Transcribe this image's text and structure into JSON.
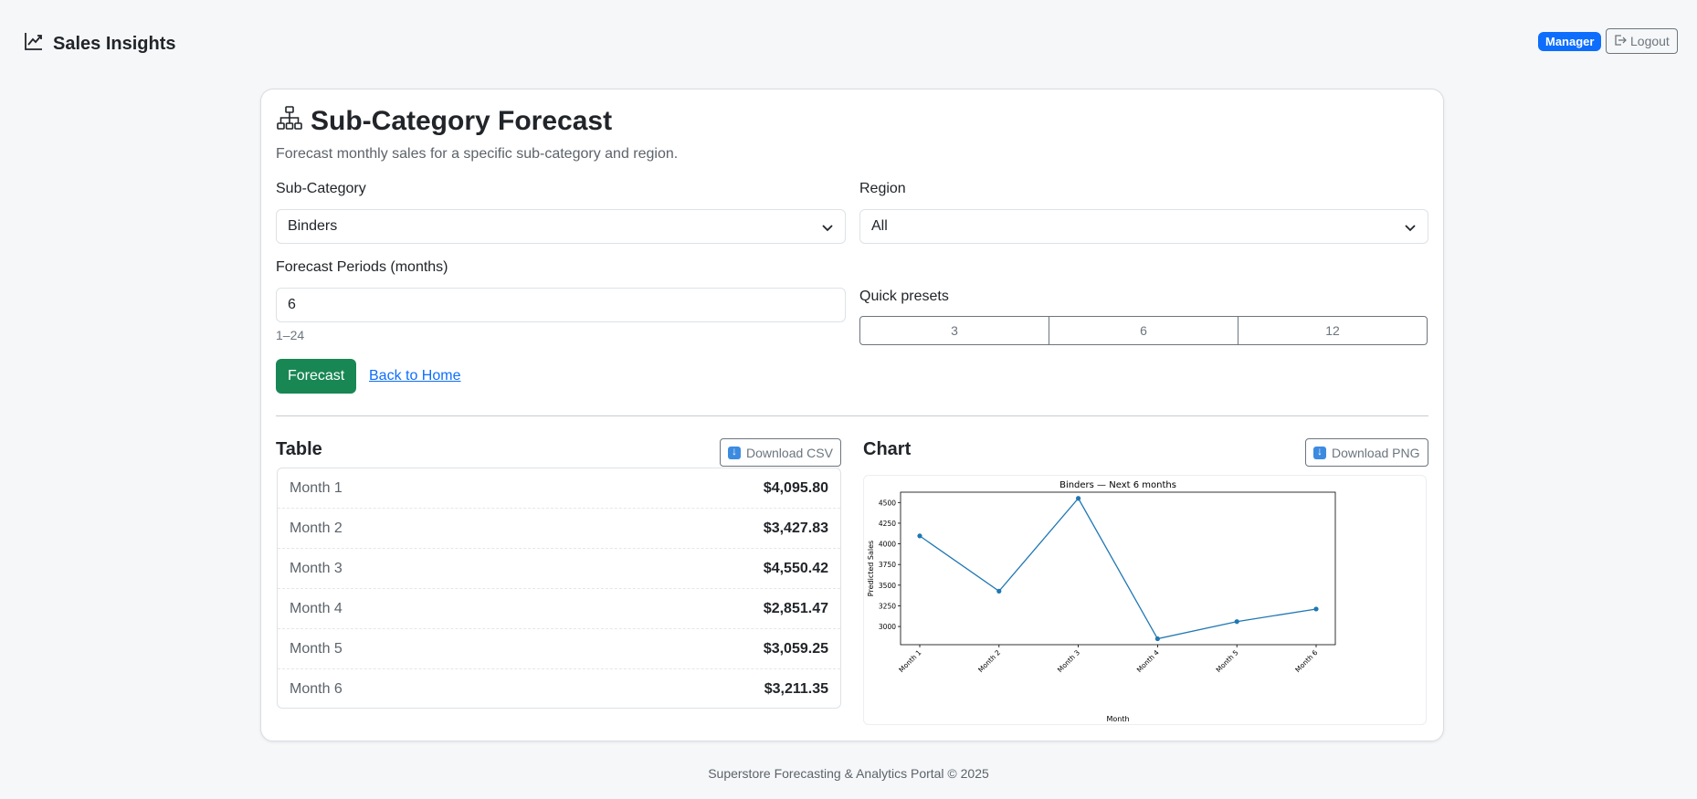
{
  "navbar": {
    "brand": "Sales Insights",
    "role_badge": "Manager",
    "logout_label": "Logout"
  },
  "page": {
    "title": "Sub-Category Forecast",
    "subtitle": "Forecast monthly sales for a specific sub-category and region."
  },
  "form": {
    "subcategory_label": "Sub-Category",
    "subcategory_value": "Binders",
    "region_label": "Region",
    "region_value": "All",
    "periods_label": "Forecast Periods (months)",
    "periods_value": "6",
    "periods_help": "1–24",
    "presets_label": "Quick presets",
    "presets": [
      "3",
      "6",
      "12"
    ],
    "forecast_button": "Forecast",
    "back_link": "Back to Home"
  },
  "table_section": {
    "title": "Table",
    "download_label": "Download CSV",
    "rows": [
      {
        "label": "Month 1",
        "value": "$4,095.80"
      },
      {
        "label": "Month 2",
        "value": "$3,427.83"
      },
      {
        "label": "Month 3",
        "value": "$4,550.42"
      },
      {
        "label": "Month 4",
        "value": "$2,851.47"
      },
      {
        "label": "Month 5",
        "value": "$3,059.25"
      },
      {
        "label": "Month 6",
        "value": "$3,211.35"
      }
    ]
  },
  "chart_section": {
    "title": "Chart",
    "download_label": "Download PNG"
  },
  "chart_data": {
    "type": "line",
    "title": "Binders — Next 6 months",
    "xlabel": "Month",
    "ylabel": "Predicted Sales",
    "categories": [
      "Month 1",
      "Month 2",
      "Month 3",
      "Month 4",
      "Month 5",
      "Month 6"
    ],
    "values": [
      4095.8,
      3427.83,
      4550.42,
      2851.47,
      3059.25,
      3211.35
    ],
    "yticks": [
      3000,
      3250,
      3500,
      3750,
      4000,
      4250,
      4500
    ],
    "ylim": [
      2780,
      4625
    ],
    "color": "#1f77b4",
    "grid": false
  },
  "footer": {
    "text": "Superstore Forecasting & Analytics Portal © 2025"
  },
  "colors": {
    "primary": "#0d6efd",
    "success": "#198754",
    "secondary": "#6c757d"
  }
}
